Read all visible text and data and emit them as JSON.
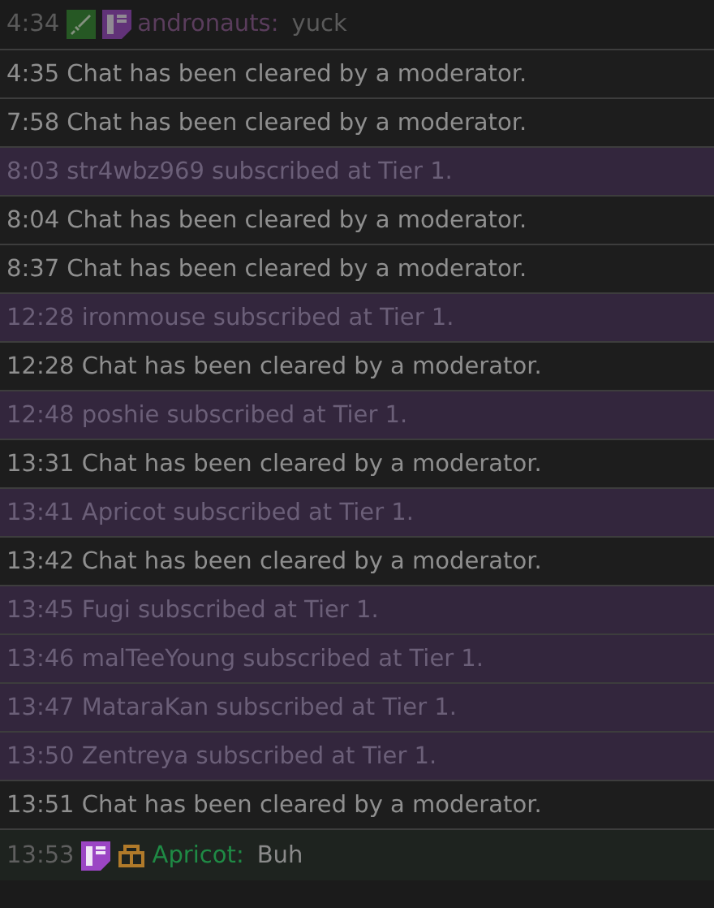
{
  "messages": [
    {
      "kind": "chat",
      "time": "4:34",
      "badges": [
        {
          "kind": "sword"
        },
        {
          "kind": "first"
        }
      ],
      "user": "andronauts:",
      "color": "#5a3d5c",
      "text": "yuck",
      "highlighted": false,
      "dimmed": true
    },
    {
      "kind": "notice",
      "time": "4:35",
      "text": "Chat has been cleared by a moderator."
    },
    {
      "kind": "notice",
      "time": "7:58",
      "text": "Chat has been cleared by a moderator."
    },
    {
      "kind": "sub",
      "time": "8:03",
      "text": "str4wbz969 subscribed at Tier 1."
    },
    {
      "kind": "notice",
      "time": "8:04",
      "text": "Chat has been cleared by a moderator."
    },
    {
      "kind": "notice",
      "time": "8:37",
      "text": "Chat has been cleared by a moderator."
    },
    {
      "kind": "sub",
      "time": "12:28",
      "text": "ironmouse subscribed at Tier 1."
    },
    {
      "kind": "notice",
      "time": "12:28",
      "text": "Chat has been cleared by a moderator."
    },
    {
      "kind": "sub",
      "time": "12:48",
      "text": "poshie subscribed at Tier 1."
    },
    {
      "kind": "notice",
      "time": "13:31",
      "text": "Chat has been cleared by a moderator."
    },
    {
      "kind": "sub",
      "time": "13:41",
      "text": "Apricot subscribed at Tier 1."
    },
    {
      "kind": "notice",
      "time": "13:42",
      "text": "Chat has been cleared by a moderator."
    },
    {
      "kind": "sub",
      "time": "13:45",
      "text": "Fugi subscribed at Tier 1."
    },
    {
      "kind": "sub",
      "time": "13:46",
      "text": "malTeeYoung subscribed at Tier 1."
    },
    {
      "kind": "sub",
      "time": "13:47",
      "text": "MataraKan subscribed at Tier 1."
    },
    {
      "kind": "sub",
      "time": "13:50",
      "text": "Zentreya subscribed at Tier 1."
    },
    {
      "kind": "notice",
      "time": "13:51",
      "text": "Chat has been cleared by a moderator."
    },
    {
      "kind": "chat",
      "time": "13:53",
      "badges": [
        {
          "kind": "first"
        },
        {
          "kind": "crate"
        }
      ],
      "user": "Apricot:",
      "color": "#1f8a45",
      "text": "Buh",
      "highlighted": true,
      "dimmed": false
    }
  ]
}
